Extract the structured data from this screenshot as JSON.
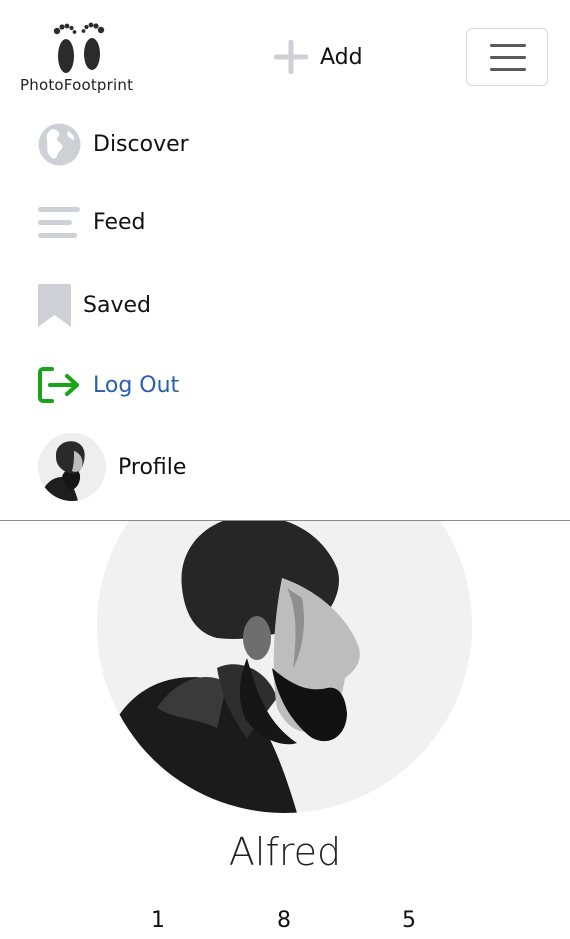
{
  "header": {
    "logo_text": "PhotoFootprint",
    "add_label": "Add"
  },
  "nav": {
    "items": [
      {
        "label": "Discover",
        "icon": "globe-icon"
      },
      {
        "label": "Feed",
        "icon": "feed-lines-icon"
      },
      {
        "label": "Saved",
        "icon": "bookmark-icon"
      },
      {
        "label": "Log Out",
        "icon": "logout-arrow-icon"
      },
      {
        "label": "Profile",
        "icon": "avatar"
      }
    ]
  },
  "profile": {
    "name": "Alfred",
    "stats": [
      "1",
      "8",
      "5"
    ]
  },
  "colors": {
    "icon_gray": "#cfcfd6",
    "logout_green": "#19a319",
    "logout_text": "#2a5fb0",
    "divider": "#8a8a8a"
  }
}
